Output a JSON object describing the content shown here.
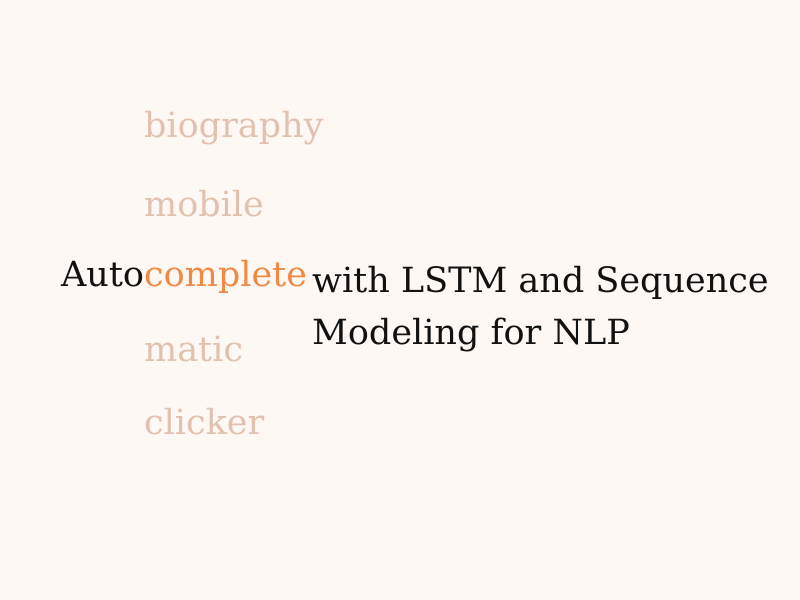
{
  "suggestions": [
    {
      "text": "biography"
    },
    {
      "text": "mobile"
    },
    {
      "text": "matic"
    },
    {
      "text": "clicker"
    }
  ],
  "title": {
    "prefix": "Auto",
    "completion": "complete",
    "rest_line1": "with LSTM and Sequence",
    "rest_line2": "Modeling for NLP"
  },
  "colors": {
    "background": "#fdf8f4",
    "suggestion": "#e2c1ae",
    "highlight": "#f08a45",
    "text": "#111111"
  }
}
